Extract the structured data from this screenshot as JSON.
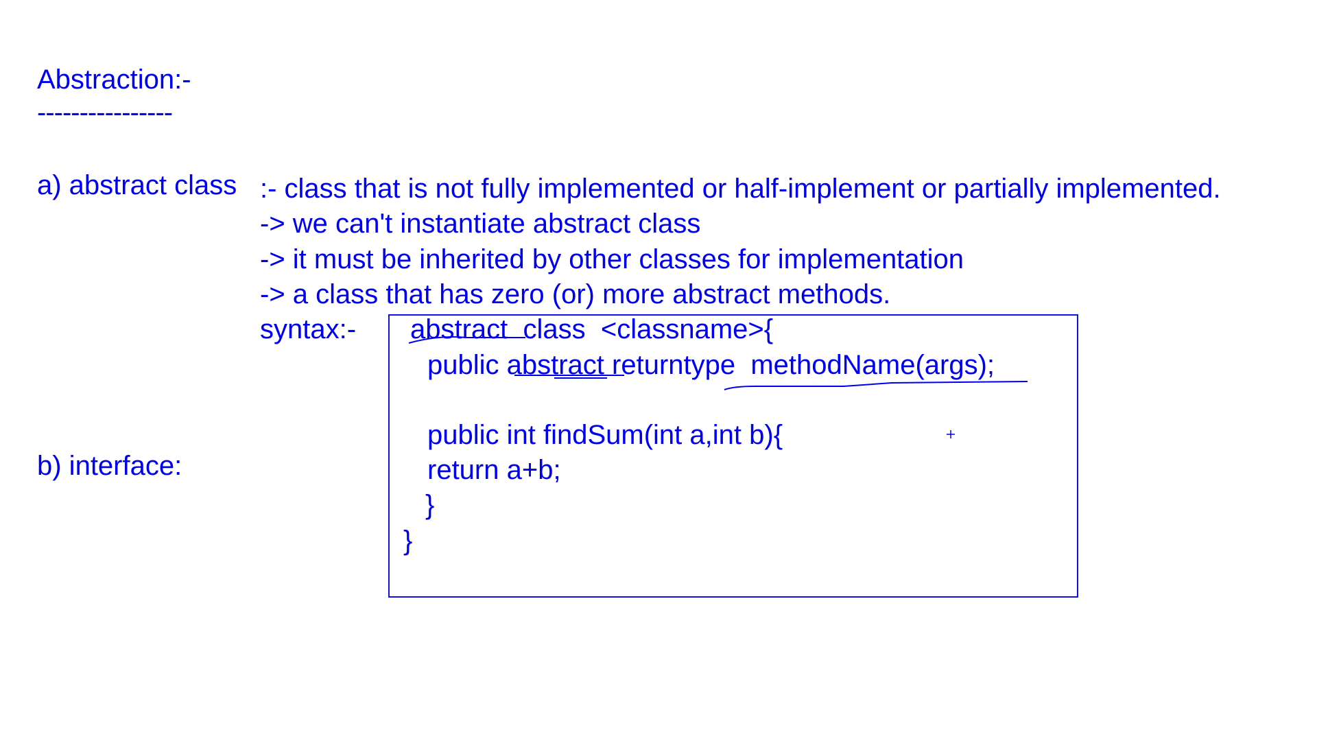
{
  "title": "Abstraction:-",
  "title_rule": "----------------",
  "section_a": {
    "label": "a) abstract class",
    "definition": ":- class that is not fully implemented or half-implement or partially implemented.",
    "points": [
      "-> we can't instantiate abstract class",
      "-> it must be inherited by other classes for implementation",
      "-> a class that has zero (or) more abstract methods."
    ],
    "syntax_label": "syntax:-",
    "code": [
      "abstract  class  <classname>{",
      "public abstract returntype  methodName(args);",
      "public int findSum(int a,int b){",
      "return a+b;",
      "}",
      "}"
    ]
  },
  "section_b": {
    "label": "b) interface:"
  },
  "ink_color": "#0000f0"
}
